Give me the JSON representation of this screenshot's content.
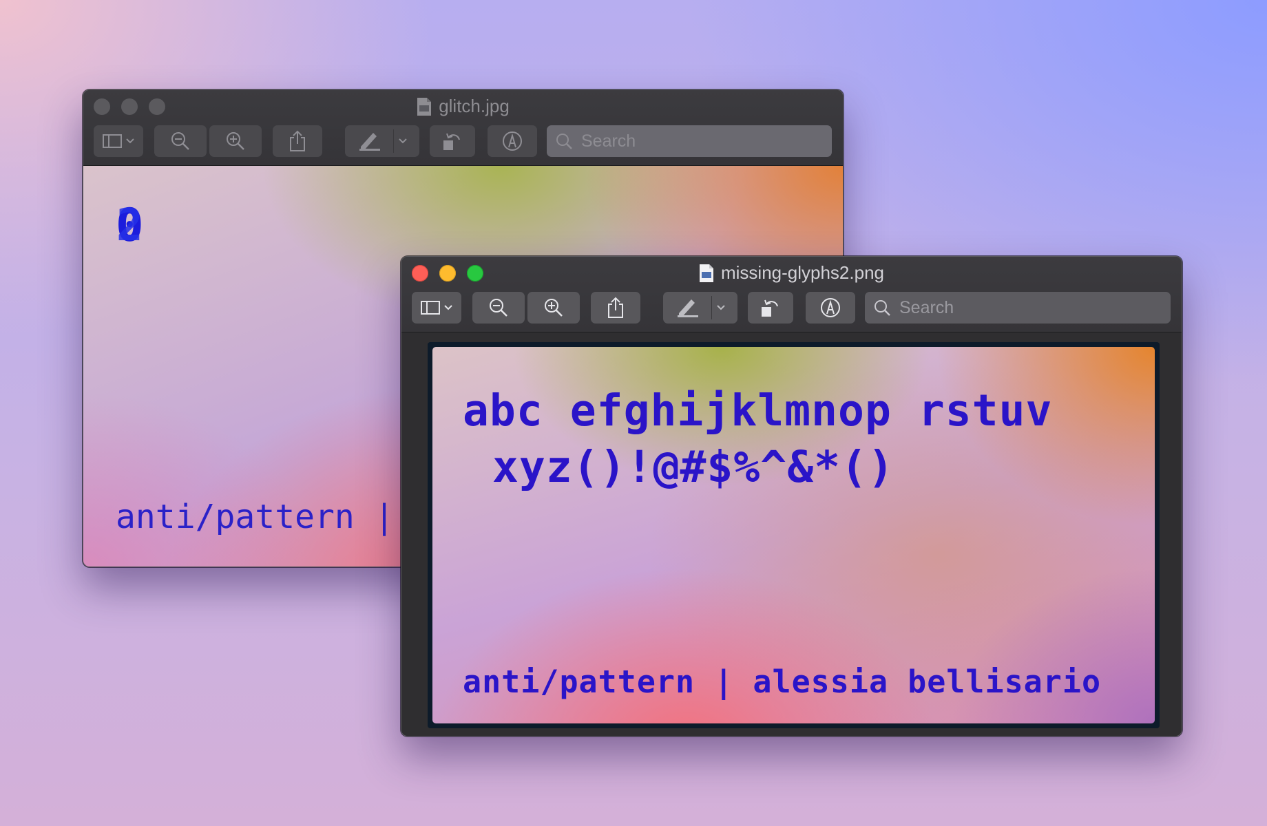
{
  "back_window": {
    "title": "glitch.jpg",
    "search_placeholder": "Search",
    "image": {
      "glitch_glyph_description": "overlapping 0/2 glyphs",
      "signature": "anti/pattern |"
    }
  },
  "front_window": {
    "title": "missing-glyphs2.png",
    "search_placeholder": "Search",
    "image": {
      "line1": "abc efghijklmnop rstuv",
      "line2": "xyz()!@#$%^&*()",
      "signature": "anti/pattern | alessia bellisario"
    }
  },
  "colors": {
    "text_blue": "#2a14c8",
    "close": "#fe5f57",
    "minimize": "#febb2e",
    "zoom": "#28c840"
  }
}
